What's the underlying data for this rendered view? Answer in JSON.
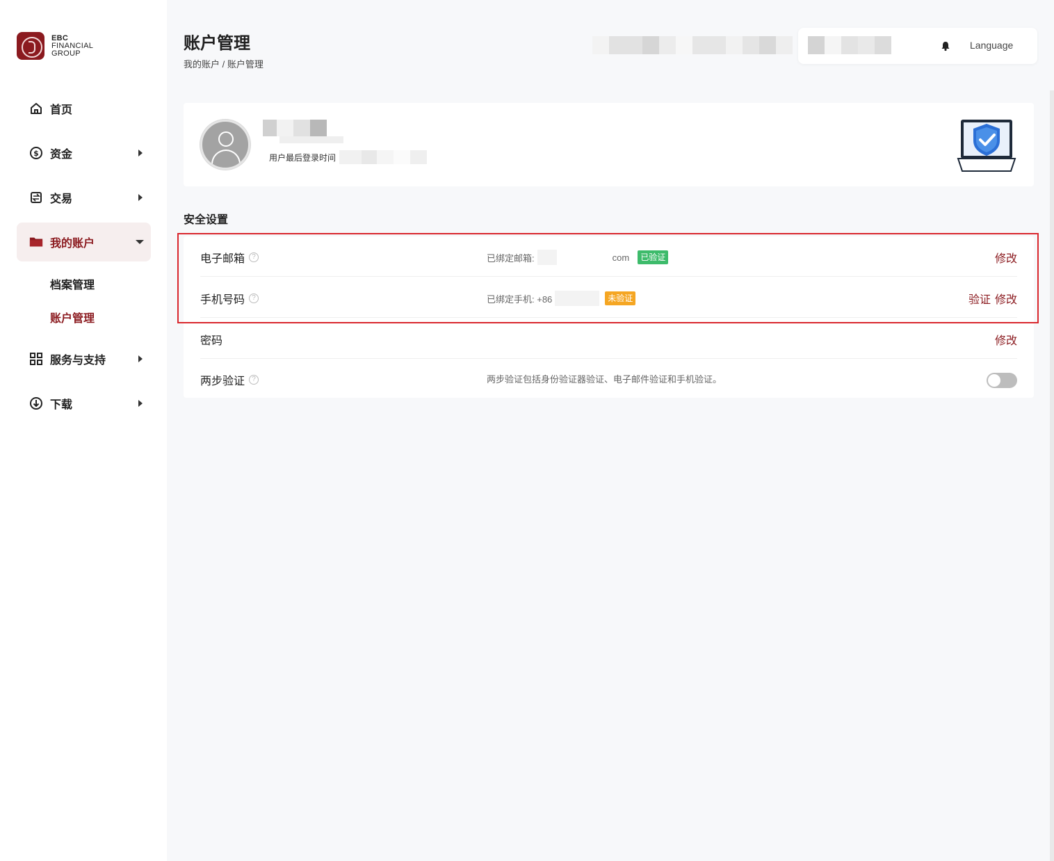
{
  "brand": {
    "line1": "EBC",
    "line2": "FINANCIAL",
    "line3": "GROUP",
    "color": "#8b1a1f"
  },
  "sidebar": {
    "items": [
      {
        "label": "首页",
        "icon": "home-icon"
      },
      {
        "label": "资金",
        "icon": "dollar-circle-icon"
      },
      {
        "label": "交易",
        "icon": "exchange-icon"
      },
      {
        "label": "我的账户",
        "icon": "folder-icon"
      },
      {
        "label": "服务与支持",
        "icon": "grid-icon"
      },
      {
        "label": "下载",
        "icon": "download-icon"
      }
    ],
    "sub_items": [
      "档案管理",
      "账户管理"
    ]
  },
  "header": {
    "title": "账户管理",
    "breadcrumb": "我的账户 / 账户管理",
    "language": "Language",
    "bell_icon": "bell-icon"
  },
  "profile": {
    "last_login_label": "用户最后登录时间"
  },
  "security": {
    "title": "安全设置",
    "rows": [
      {
        "label": "电子邮箱",
        "desc_prefix": "已绑定邮箱:",
        "desc_suffix": "com",
        "badge": "已验证",
        "actions": [
          "修改"
        ]
      },
      {
        "label": "手机号码",
        "desc_prefix": "已绑定手机: +86",
        "badge": "未验证",
        "actions": [
          "验证",
          "修改"
        ]
      },
      {
        "label": "密码",
        "actions": [
          "修改"
        ]
      },
      {
        "label": "两步验证",
        "desc": "两步验证包括身份验证器验证、电子邮件验证和手机验证。",
        "toggle": "off"
      }
    ]
  }
}
